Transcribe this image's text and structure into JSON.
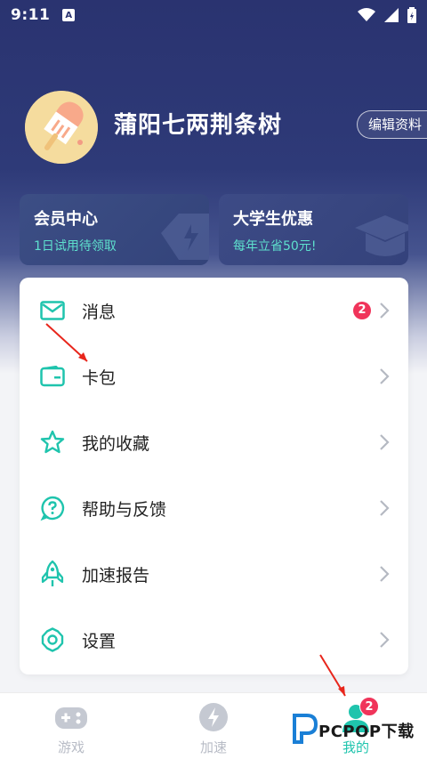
{
  "status_bar": {
    "time": "9:11",
    "notification_letter": "A"
  },
  "profile": {
    "username": "蒲阳七两荆条树",
    "edit_label": "编辑资料"
  },
  "promos": [
    {
      "title": "会员中心",
      "subtitle": "1日试用待领取"
    },
    {
      "title": "大学生优惠",
      "subtitle": "每年立省50元!"
    }
  ],
  "menu": [
    {
      "label": "消息",
      "icon": "mail-icon",
      "badge": "2"
    },
    {
      "label": "卡包",
      "icon": "wallet-icon"
    },
    {
      "label": "我的收藏",
      "icon": "star-icon"
    },
    {
      "label": "帮助与反馈",
      "icon": "help-icon"
    },
    {
      "label": "加速报告",
      "icon": "rocket-icon"
    },
    {
      "label": "设置",
      "icon": "gear-icon"
    }
  ],
  "tabs": [
    {
      "label": "游戏",
      "icon": "gamepad-icon"
    },
    {
      "label": "加速",
      "icon": "bolt-icon"
    },
    {
      "label": "我的",
      "icon": "person-icon",
      "badge": "2",
      "active": true
    }
  ],
  "watermark": {
    "text": "PCPOP下载"
  },
  "colors": {
    "accent": "#1fc4ad",
    "badge": "#f0345a",
    "header_bg": "#2a3370"
  }
}
